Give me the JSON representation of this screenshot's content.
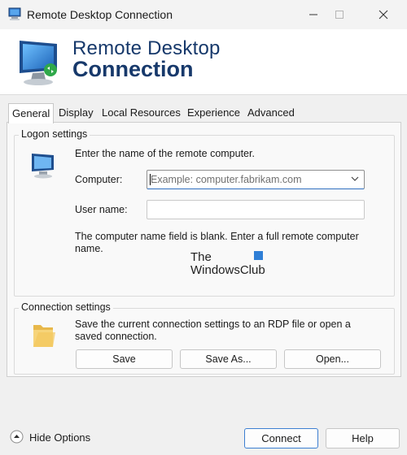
{
  "window": {
    "title": "Remote Desktop Connection"
  },
  "banner": {
    "line1": "Remote Desktop",
    "line2": "Connection"
  },
  "tabs": [
    {
      "label": "General",
      "active": true
    },
    {
      "label": "Display"
    },
    {
      "label": "Local Resources"
    },
    {
      "label": "Experience"
    },
    {
      "label": "Advanced"
    }
  ],
  "logon": {
    "title": "Logon settings",
    "intro": "Enter the name of the remote computer.",
    "computer_label": "Computer:",
    "computer_placeholder": "Example: computer.fabrikam.com",
    "username_label": "User name:",
    "username_value": "",
    "warning": "The computer name field is blank. Enter a full remote computer name."
  },
  "watermark": {
    "line1": "The",
    "line2": "WindowsClub"
  },
  "connection": {
    "title": "Connection settings",
    "description": "Save the current connection settings to an RDP file or open a saved connection.",
    "save_label": "Save",
    "save_as_label": "Save As...",
    "open_label": "Open..."
  },
  "footer": {
    "hide_options_label": "Hide Options",
    "connect_label": "Connect",
    "help_label": "Help"
  },
  "colors": {
    "banner_text": "#17396b",
    "accent": "#3d7fd1",
    "window_bg": "#f0f0f0"
  }
}
